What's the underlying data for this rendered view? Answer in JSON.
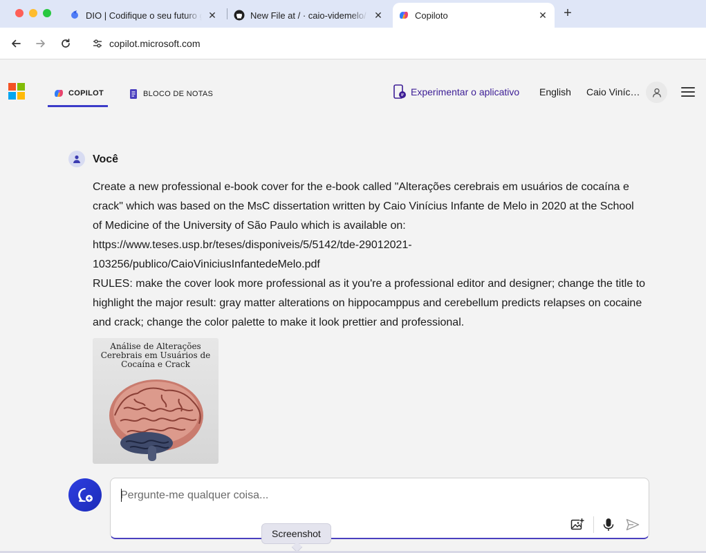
{
  "browser": {
    "tabs": [
      {
        "title": "DIO | Codifique o seu futuro g",
        "icon": "dio-icon"
      },
      {
        "title": "New File at / · caio-videmelo/",
        "icon": "github-icon"
      },
      {
        "title": "Copiloto",
        "icon": "copilot-icon"
      }
    ],
    "url": "copilot.microsoft.com"
  },
  "header": {
    "nav": {
      "copilot": "COPILOT",
      "notebook": "BLOCO DE NOTAS"
    },
    "try_app": "Experimentar o aplicativo",
    "language": "English",
    "user_name": "Caio Viníc…"
  },
  "conversation": {
    "author": "Você",
    "message_lines": [
      "Create a new professional e-book cover for the e-book called \"Alterações cerebrais em usuários de cocaína e crack\" which was based on the MsC dissertation written by Caio Vinícius Infante de Melo in 2020 at the School of Medicine of the University of São Paulo which is available on:",
      "https://www.teses.usp.br/teses/disponiveis/5/5142/tde-29012021-103256/publico/CaioViniciusInfantedeMelo.pdf",
      "RULES: make the cover look more professional as it you're a professional editor and designer; change the title to highlight the major result: gray matter alterations on hippocamppus and cerebellum predicts relapses on cocaine and crack; change the color palette to make it look prettier and professional."
    ],
    "image_title_lines": [
      "Análise de Alterações",
      "Cerebrais em Usuários de",
      "Cocaína e Crack"
    ]
  },
  "composer": {
    "placeholder": "Pergunte-me qualquer coisa...",
    "value": ""
  },
  "tooltip": "Screenshot",
  "colors": {
    "accent": "#3b3bc8",
    "try_app": "#3c1d95",
    "new_topic": "#2d3ee0"
  }
}
